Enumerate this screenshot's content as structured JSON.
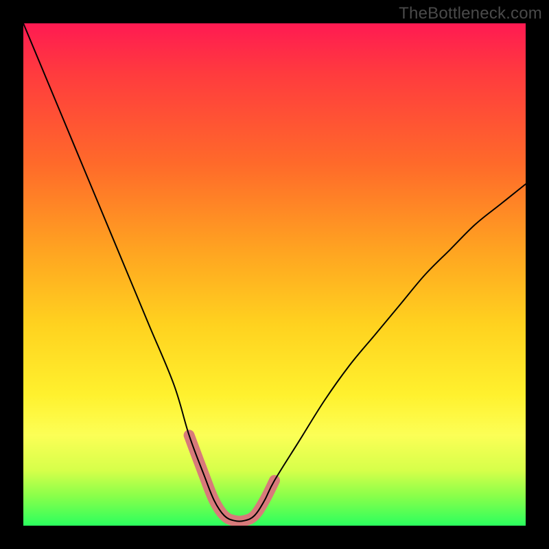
{
  "watermark": "TheBottleneck.com",
  "colors": {
    "frame": "#000000",
    "curve": "#000000",
    "highlight": "#d87a7a"
  },
  "chart_data": {
    "type": "line",
    "title": "",
    "xlabel": "",
    "ylabel": "",
    "xlim": [
      0,
      100
    ],
    "ylim": [
      0,
      100
    ],
    "grid": false,
    "series": [
      {
        "name": "bottleneck-curve",
        "x": [
          0,
          5,
          10,
          15,
          20,
          25,
          30,
          33,
          36,
          38,
          40,
          42,
          44,
          46,
          48,
          50,
          55,
          60,
          65,
          70,
          75,
          80,
          85,
          90,
          95,
          100
        ],
        "values": [
          100,
          88,
          76,
          64,
          52,
          40,
          28,
          18,
          10,
          5,
          2,
          1,
          1,
          2,
          5,
          9,
          17,
          25,
          32,
          38,
          44,
          50,
          55,
          60,
          64,
          68
        ]
      }
    ],
    "annotations": [
      {
        "name": "highlight-trough",
        "x_range": [
          33,
          50
        ],
        "note": "pink U-shaped highlight near minimum"
      }
    ]
  }
}
